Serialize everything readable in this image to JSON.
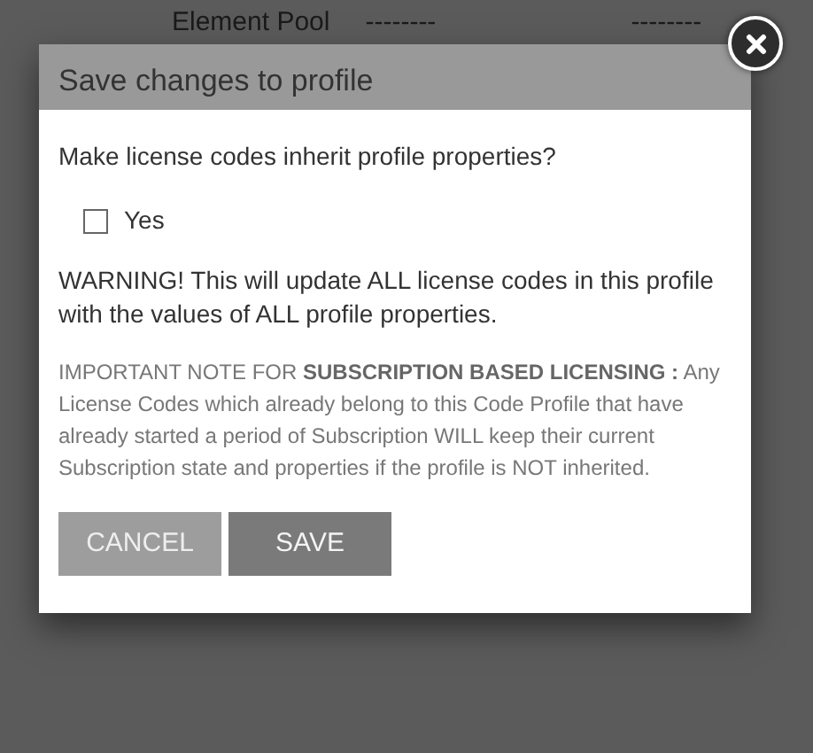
{
  "background": {
    "label": "Element Pool",
    "column_2": "--------",
    "column_3": "--------"
  },
  "dialog": {
    "title": "Save changes to profile",
    "question": "Make license codes inherit profile properties?",
    "checkbox": {
      "label": "Yes",
      "checked": false
    },
    "warning": "WARNING! This will update ALL license codes in this profile with the values of ALL profile properties.",
    "note": "IMPORTANT NOTE FOR **SUBSCRIPTION BASED LICENSING :** Any License Codes which already belong to this Code Profile that have already started a period of Subscription WILL keep their current Subscription state and properties if the profile is NOT inherited.",
    "buttons": [
      {
        "label": "CANCEL",
        "kind": "secondary"
      },
      {
        "label": "SAVE",
        "kind": "primary"
      }
    ]
  }
}
